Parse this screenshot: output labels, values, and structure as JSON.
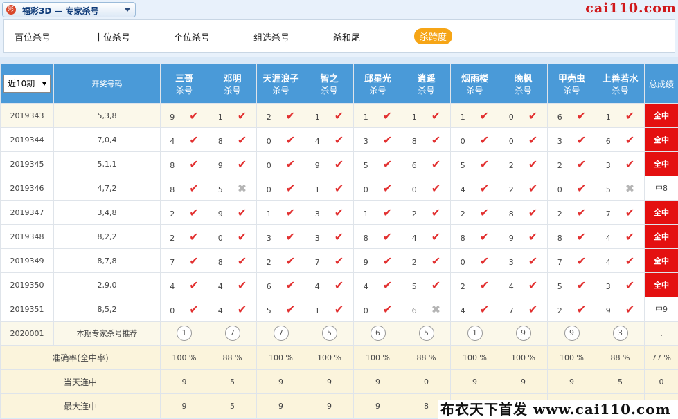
{
  "topbar": {
    "selector_logo": "彩",
    "selector_label": "福彩3D — 专家杀号",
    "brand": "cai110.com"
  },
  "tabs": [
    "百位杀号",
    "十位杀号",
    "个位杀号",
    "组选杀号",
    "杀和尾",
    "杀跨度"
  ],
  "active_tab": "杀跨度",
  "table": {
    "period_select": "近10期",
    "col_draw": "开奖号码",
    "col_total": "总成绩",
    "experts": [
      {
        "name": "三哥",
        "sub": "杀号"
      },
      {
        "name": "邓明",
        "sub": "杀号"
      },
      {
        "name": "天涯浪子",
        "sub": "杀号"
      },
      {
        "name": "智之",
        "sub": "杀号"
      },
      {
        "name": "邱星光",
        "sub": "杀号"
      },
      {
        "name": "逍遥",
        "sub": "杀号"
      },
      {
        "name": "烟雨楼",
        "sub": "杀号"
      },
      {
        "name": "晚枫",
        "sub": "杀号"
      },
      {
        "name": "甲壳虫",
        "sub": "杀号"
      },
      {
        "name": "上善若水",
        "sub": "杀号"
      }
    ],
    "rows": [
      {
        "issue": "2019343",
        "draw": "5,3,8",
        "picks": [
          "9",
          "1",
          "2",
          "1",
          "1",
          "1",
          "1",
          "0",
          "6",
          "1"
        ],
        "hits": [
          1,
          1,
          1,
          1,
          1,
          1,
          1,
          1,
          1,
          1
        ],
        "total": "全中"
      },
      {
        "issue": "2019344",
        "draw": "7,0,4",
        "picks": [
          "4",
          "8",
          "0",
          "4",
          "3",
          "8",
          "0",
          "0",
          "3",
          "6"
        ],
        "hits": [
          1,
          1,
          1,
          1,
          1,
          1,
          1,
          1,
          1,
          1
        ],
        "total": "全中"
      },
      {
        "issue": "2019345",
        "draw": "5,1,1",
        "picks": [
          "8",
          "9",
          "0",
          "9",
          "5",
          "6",
          "5",
          "2",
          "2",
          "3"
        ],
        "hits": [
          1,
          1,
          1,
          1,
          1,
          1,
          1,
          1,
          1,
          1
        ],
        "total": "全中"
      },
      {
        "issue": "2019346",
        "draw": "4,7,2",
        "picks": [
          "8",
          "5",
          "0",
          "1",
          "0",
          "0",
          "4",
          "2",
          "0",
          "5"
        ],
        "hits": [
          1,
          0,
          1,
          1,
          1,
          1,
          1,
          1,
          1,
          0
        ],
        "total": "中8"
      },
      {
        "issue": "2019347",
        "draw": "3,4,8",
        "picks": [
          "2",
          "9",
          "1",
          "3",
          "1",
          "2",
          "2",
          "8",
          "2",
          "7"
        ],
        "hits": [
          1,
          1,
          1,
          1,
          1,
          1,
          1,
          1,
          1,
          1
        ],
        "total": "全中"
      },
      {
        "issue": "2019348",
        "draw": "8,2,2",
        "picks": [
          "2",
          "0",
          "3",
          "3",
          "8",
          "4",
          "8",
          "9",
          "8",
          "4"
        ],
        "hits": [
          1,
          1,
          1,
          1,
          1,
          1,
          1,
          1,
          1,
          1
        ],
        "total": "全中"
      },
      {
        "issue": "2019349",
        "draw": "8,7,8",
        "picks": [
          "7",
          "8",
          "2",
          "7",
          "9",
          "2",
          "0",
          "3",
          "7",
          "4"
        ],
        "hits": [
          1,
          1,
          1,
          1,
          1,
          1,
          1,
          1,
          1,
          1
        ],
        "total": "全中"
      },
      {
        "issue": "2019350",
        "draw": "2,9,0",
        "picks": [
          "4",
          "4",
          "6",
          "4",
          "4",
          "5",
          "2",
          "4",
          "5",
          "3"
        ],
        "hits": [
          1,
          1,
          1,
          1,
          1,
          1,
          1,
          1,
          1,
          1
        ],
        "total": "全中"
      },
      {
        "issue": "2019351",
        "draw": "8,5,2",
        "picks": [
          "0",
          "4",
          "5",
          "1",
          "0",
          "6",
          "4",
          "7",
          "2",
          "9"
        ],
        "hits": [
          1,
          1,
          1,
          1,
          1,
          0,
          1,
          1,
          1,
          1
        ],
        "total": "中9"
      }
    ],
    "recommend": {
      "issue": "2020001",
      "label": "本期专家杀号推荐",
      "picks": [
        "1",
        "7",
        "7",
        "5",
        "6",
        "5",
        "1",
        "9",
        "9",
        "3"
      ],
      "total": "."
    },
    "stats": [
      {
        "label": "准确率(全中率)",
        "values": [
          "100 %",
          "88 %",
          "100 %",
          "100 %",
          "100 %",
          "88 %",
          "100 %",
          "100 %",
          "100 %",
          "88 %"
        ],
        "total": "77 %"
      },
      {
        "label": "当天连中",
        "values": [
          "9",
          "5",
          "9",
          "9",
          "9",
          "0",
          "9",
          "9",
          "9",
          "5"
        ],
        "total": "0"
      },
      {
        "label": "最大连中",
        "values": [
          "9",
          "5",
          "9",
          "9",
          "9",
          "8",
          "",
          "",
          "",
          ""
        ],
        "total": ""
      }
    ]
  },
  "footer_logo": "布衣天下首发 www.cai110.com"
}
